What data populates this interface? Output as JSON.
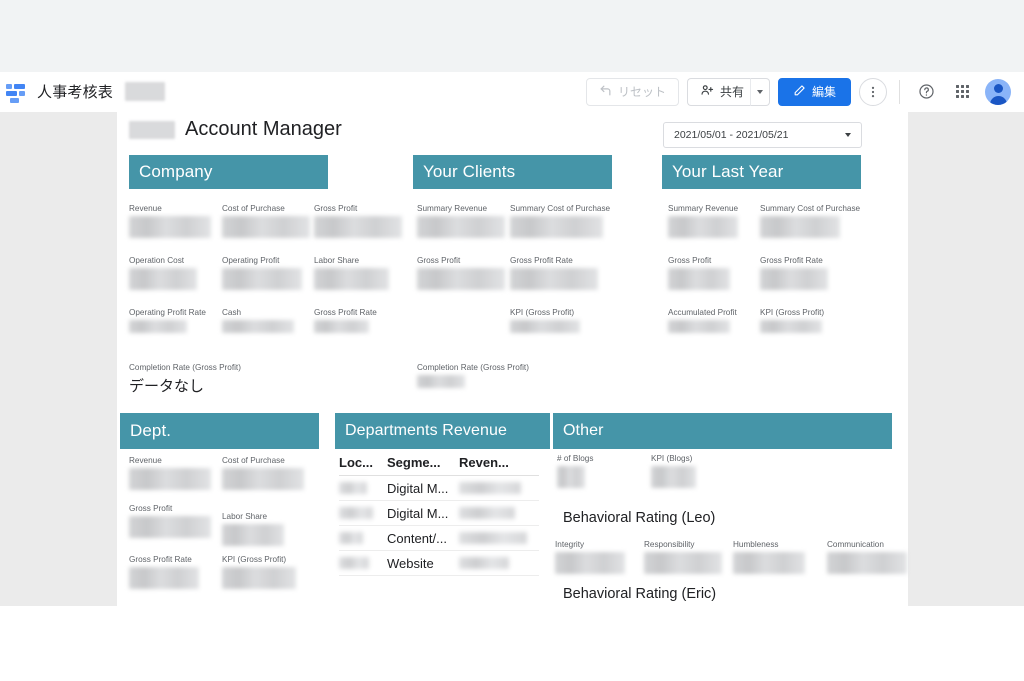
{
  "header": {
    "doc_title": "人事考核表",
    "reset_label": "リセット",
    "share_label": "共有",
    "edit_label": "編集"
  },
  "report": {
    "page_title": "Account Manager",
    "date_range": "2021/05/01 - 2021/05/21",
    "accent_color": "#4595a8",
    "sections": {
      "company": {
        "title": "Company",
        "kpis": [
          "Revenue",
          "Cost of Purchase",
          "Gross Profit",
          "Operation Cost",
          "Operating Profit",
          "Labor Share",
          "Operating Profit Rate",
          "Cash",
          "Gross Profit Rate"
        ],
        "completion_label": "Completion Rate (Gross Profit)",
        "completion_value": "データなし"
      },
      "clients": {
        "title": "Your Clients",
        "kpis": [
          "Summary Revenue",
          "Summary Cost of Purchase",
          "Gross Profit",
          "Gross Profit Rate",
          "KPI (Gross Profit)"
        ],
        "completion_label": "Completion Rate (Gross Profit)"
      },
      "last_year": {
        "title": "Your Last Year",
        "kpis": [
          "Summary Revenue",
          "Summary Cost of Purchase",
          "Gross Profit",
          "Gross Profit Rate",
          "Accumulated Profit",
          "KPI (Gross Profit)"
        ]
      },
      "dept": {
        "title": "Dept.",
        "kpis": [
          "Revenue",
          "Cost of Purchase",
          "Gross Profit",
          "Labor Share",
          "Gross Profit Rate",
          "KPI (Gross Profit)"
        ]
      },
      "departments_revenue": {
        "title": "Departments Revenue",
        "columns": [
          "Loc...",
          "Segme...",
          "Reven..."
        ],
        "rows": [
          {
            "location": "",
            "segment": "Digital M...",
            "revenue": ""
          },
          {
            "location": "",
            "segment": "Digital M...",
            "revenue": ""
          },
          {
            "location": "",
            "segment": "Content/...",
            "revenue": ""
          },
          {
            "location": "",
            "segment": "Website",
            "revenue": ""
          }
        ]
      },
      "other": {
        "title": "Other",
        "kpis": [
          "# of Blogs",
          "KPI (Blogs)"
        ],
        "behavioral_leo": "Behavioral Rating (Leo)",
        "behavioral_metrics": [
          "Integrity",
          "Responsibility",
          "Humbleness",
          "Communication"
        ],
        "behavioral_eric": "Behavioral Rating (Eric)"
      }
    }
  }
}
